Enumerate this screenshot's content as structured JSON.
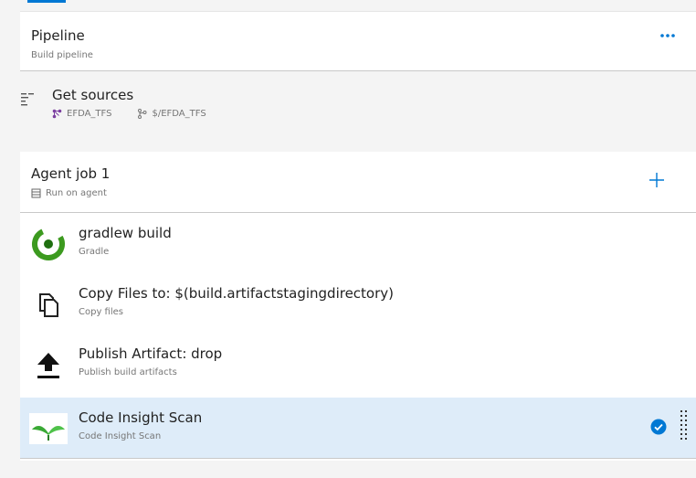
{
  "pipeline": {
    "title": "Pipeline",
    "subtitle": "Build pipeline",
    "more_icon": "ellipsis-icon"
  },
  "get_sources": {
    "title": "Get sources",
    "repo": "EFDA_TFS",
    "path": "$/EFDA_TFS"
  },
  "agent_job": {
    "title": "Agent job 1",
    "subtitle": "Run on agent",
    "add_icon": "plus-icon"
  },
  "tasks": [
    {
      "name": "gradlew build",
      "type": "Gradle",
      "icon": "gradle-icon"
    },
    {
      "name": "Copy Files to: $(build.artifactstagingdirectory)",
      "type": "Copy files",
      "icon": "copy-files-icon"
    },
    {
      "name": "Publish Artifact: drop",
      "type": "Publish build artifacts",
      "icon": "upload-icon"
    },
    {
      "name": "Code Insight Scan",
      "type": "Code Insight Scan",
      "icon": "code-insight-icon",
      "selected": true
    }
  ],
  "colors": {
    "accent": "#0078d4",
    "selected_bg": "#deecf9",
    "gradle_green": "#3c9a1f",
    "insight_green": "#4caf50"
  }
}
